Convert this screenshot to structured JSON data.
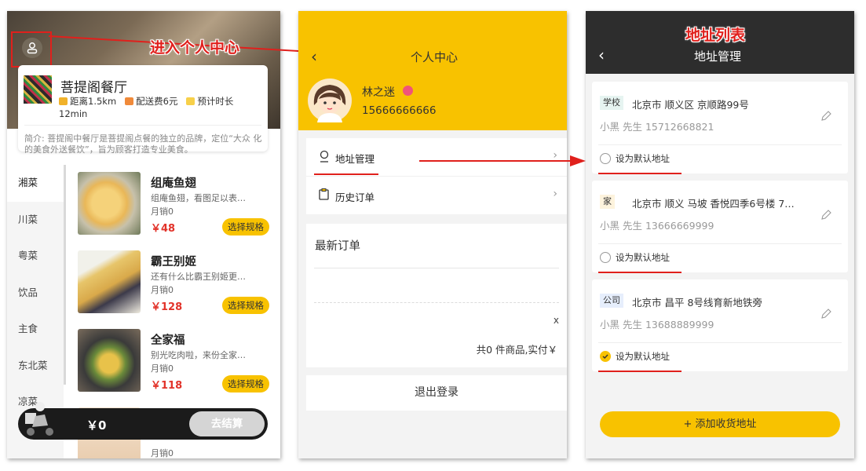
{
  "panel1": {
    "shop": {
      "name": "菩提阁餐厅",
      "distance": "距离1.5km",
      "delivery_fee": "配送费6元",
      "eta_label": "预计时长",
      "eta_value": "12min",
      "intro": "简介: 菩提阁中餐厅是菩提阁点餐的独立的品牌，定位“大众 化的美食外送餐饮”，旨为顾客打造专业美食。"
    },
    "categories": [
      "湘菜",
      "川菜",
      "粤菜",
      "饮品",
      "主食",
      "东北菜",
      "凉菜"
    ],
    "active_category": "湘菜",
    "dishes": [
      {
        "name": "组庵鱼翅",
        "desc": "组庵鱼翅，看图足以表…",
        "sales": "月销0",
        "price": "￥48",
        "button": "选择规格"
      },
      {
        "name": "霸王别姬",
        "desc": "还有什么比霸王别姬更…",
        "sales": "月销0",
        "price": "￥128",
        "button": "选择规格"
      },
      {
        "name": "全家福",
        "desc": "别光吃肉啦，来份全家…",
        "sales": "月销0",
        "price": "￥118",
        "button": "选择规格"
      },
      {
        "name": "",
        "desc": "",
        "sales": "月销0",
        "price": "",
        "button": ""
      }
    ],
    "cart": {
      "total": "￥0",
      "checkout": "去结算"
    }
  },
  "annotations": {
    "enter_center": "进入个人中心",
    "address_list": "地址列表"
  },
  "panel2": {
    "back": "‹",
    "title": "个人中心",
    "user_name": "林之迷",
    "phone": "15666666666",
    "menu": [
      {
        "label": "地址管理",
        "chevron": "›"
      },
      {
        "label": "历史订单",
        "chevron": "›"
      }
    ],
    "latest_orders_title": "最新订单",
    "close_x": "x",
    "order_summary": "共0 件商品,实付￥",
    "logout": "退出登录"
  },
  "panel3": {
    "back": "‹",
    "title": "地址管理",
    "addresses": [
      {
        "tag": "学校",
        "tag_color": "#e6f4f1",
        "address": "北京市 顺义区 京顺路99号",
        "contact": "小黑 先生   15712668821",
        "default_label": "设为默认地址",
        "is_default": false
      },
      {
        "tag": "家",
        "tag_color": "#fdf3dd",
        "address": "北京市 顺义 马坡 香悦四季6号楼 7…",
        "contact": "小黑 先生   13666669999",
        "default_label": "设为默认地址",
        "is_default": false
      },
      {
        "tag": "公司",
        "tag_color": "#e6eefc",
        "address": "北京市 昌平 8号线育新地铁旁",
        "contact": "小黑 先生   13688889999",
        "default_label": "设为默认地址",
        "is_default": true
      }
    ],
    "add_button": "+ 添加收货地址"
  },
  "colors": {
    "accent": "#f8c200",
    "annotation_red": "#e0201c",
    "price_red": "#e2332a",
    "dark_header": "#2d2d2d"
  }
}
